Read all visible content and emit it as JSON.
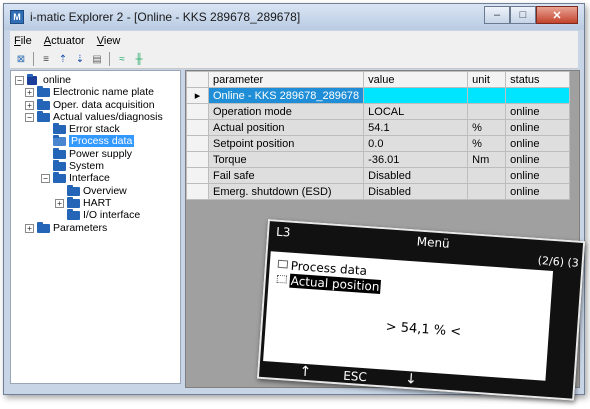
{
  "window": {
    "app_icon_glyph": "M",
    "title": "i-matic Explorer 2 - [Online - KKS 289678_289678]",
    "buttons": {
      "minimize": "–",
      "maximize": "□",
      "close": "✕"
    }
  },
  "menu": {
    "items": [
      {
        "hotkey": "F",
        "rest": "ile"
      },
      {
        "hotkey": "A",
        "rest": "ctuator"
      },
      {
        "hotkey": "V",
        "rest": "iew"
      }
    ]
  },
  "toolbar": {
    "icons": [
      "connect-icon",
      "list-icon",
      "upload-icon",
      "download-icon",
      "print-icon",
      "signal-icon",
      "chart-icon"
    ],
    "glyphs": [
      "⊠",
      "≡",
      "⇡",
      "⇣",
      "▤",
      "≈",
      "╫"
    ]
  },
  "tree": {
    "nodes": [
      {
        "label": "online",
        "level": 0,
        "expander": "−",
        "icon": "actuator-icon"
      },
      {
        "label": "Electronic name plate",
        "level": 1,
        "expander": "+",
        "icon": "folder-icon"
      },
      {
        "label": "Oper. data acquisition",
        "level": 1,
        "expander": "+",
        "icon": "folder-icon"
      },
      {
        "label": "Actual values/diagnosis",
        "level": 1,
        "expander": "−",
        "icon": "folder-icon"
      },
      {
        "label": "Error stack",
        "level": 2,
        "expander": "",
        "icon": "folder-icon"
      },
      {
        "label": "Process data",
        "level": 2,
        "expander": "",
        "icon": "open-folder-icon",
        "selected": true
      },
      {
        "label": "Power supply",
        "level": 2,
        "expander": "",
        "icon": "folder-icon"
      },
      {
        "label": "System",
        "level": 2,
        "expander": "",
        "icon": "folder-icon"
      },
      {
        "label": "Interface",
        "level": 2,
        "expander": "−",
        "icon": "folder-icon"
      },
      {
        "label": "Overview",
        "level": 3,
        "expander": "",
        "icon": "folder-icon"
      },
      {
        "label": "HART",
        "level": 3,
        "expander": "+",
        "icon": "folder-icon"
      },
      {
        "label": "I/O interface",
        "level": 3,
        "expander": "",
        "icon": "folder-icon"
      },
      {
        "label": "Parameters",
        "level": 1,
        "expander": "+",
        "icon": "folder-icon"
      }
    ]
  },
  "table": {
    "columns": [
      "parameter",
      "value",
      "unit",
      "status"
    ],
    "rows": [
      {
        "marker": "▸",
        "parameter": "Online - KKS 289678_289678",
        "value": "",
        "unit": "",
        "status": "",
        "highlight": true
      },
      {
        "marker": "",
        "parameter": "Operation mode",
        "value": "LOCAL",
        "unit": "",
        "status": "online"
      },
      {
        "marker": "",
        "parameter": "Actual position",
        "value": "54.1",
        "unit": "%",
        "status": "online"
      },
      {
        "marker": "",
        "parameter": "Setpoint position",
        "value": "0.0",
        "unit": "%",
        "status": "online"
      },
      {
        "marker": "",
        "parameter": "Torque",
        "value": "-36.01",
        "unit": "Nm",
        "status": "online"
      },
      {
        "marker": "",
        "parameter": "Fail safe",
        "value": "Disabled",
        "unit": "",
        "status": "online"
      },
      {
        "marker": "",
        "parameter": "Emerg. shutdown (ESD)",
        "value": "Disabled",
        "unit": "",
        "status": "online"
      }
    ]
  },
  "device_display": {
    "code": "L3",
    "title": "Menü",
    "page": "(2/6) (3",
    "section": "Process data",
    "selected_item": "Actual position",
    "value": "> 54,1 % <",
    "footer": {
      "up": "↑",
      "esc": "ESC",
      "down": "↓"
    }
  },
  "colors": {
    "selection": "#3399ff",
    "row_highlight": "#00e5ff",
    "folder": "#2565b8"
  }
}
